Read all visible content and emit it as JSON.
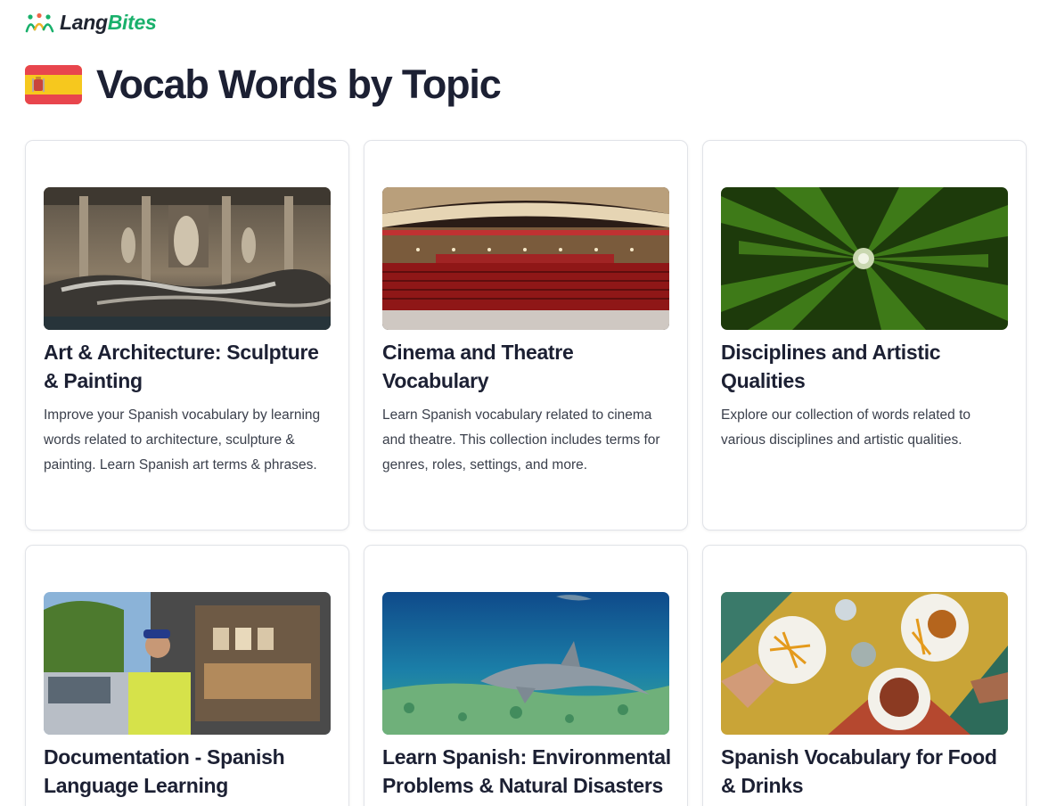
{
  "brand": {
    "name_part1": "Lang",
    "name_part2": "Bites"
  },
  "header": {
    "title": "Vocab Words by Topic",
    "flag": "spain-flag-icon"
  },
  "colors": {
    "brand_green": "#19b06b",
    "title_text": "#1c2033",
    "body_text": "#3a3f4b",
    "card_border": "#e1e3e8"
  },
  "topics": [
    {
      "title": "Art & Architecture: Sculpture & Painting",
      "description": "Improve your Spanish vocabulary by learning words related to architecture, sculpture & painting. Learn Spanish art terms & phrases.",
      "image": "trevi-fountain-night-photo"
    },
    {
      "title": "Cinema and Theatre Vocabulary",
      "description": "Learn Spanish vocabulary related to cinema and theatre. This collection includes terms for genres, roles, settings, and more.",
      "image": "theatre-auditorium-red-seats-photo"
    },
    {
      "title": "Disciplines and Artistic Qualities",
      "description": "Explore our collection of words related to various disciplines and artistic qualities.",
      "image": "green-leaves-radial-macro-photo"
    },
    {
      "title": "Documentation - Spanish Language Learning",
      "description": "",
      "image": "market-van-vendor-photo"
    },
    {
      "title": "Learn Spanish: Environmental Problems & Natural Disasters",
      "description": "",
      "image": "dolphin-underwater-photo"
    },
    {
      "title": "Spanish Vocabulary for Food & Drinks",
      "description": "",
      "image": "food-table-overhead-photo"
    }
  ]
}
